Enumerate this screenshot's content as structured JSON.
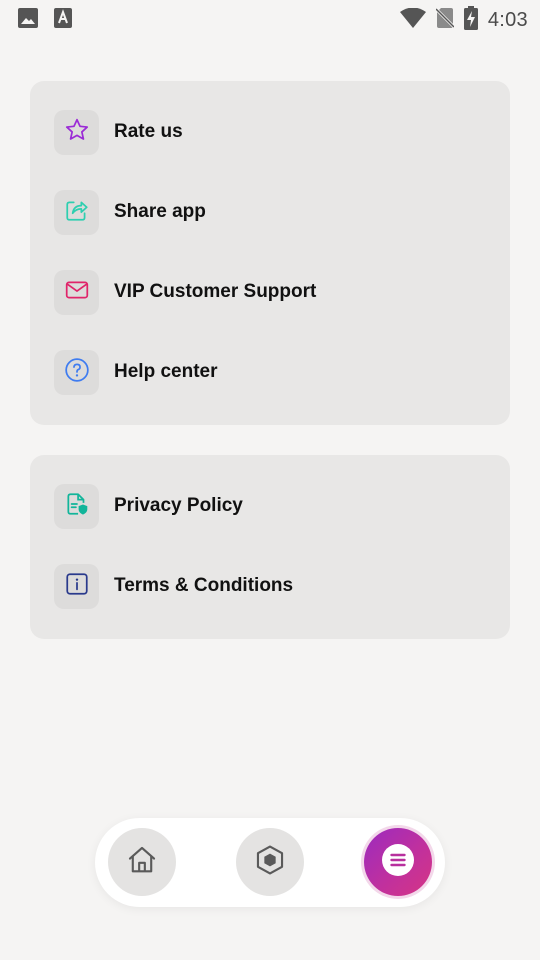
{
  "status_bar": {
    "time": "4:03",
    "left_icons": [
      "image-icon",
      "keyboard-a-icon"
    ],
    "right_icons": [
      "wifi-icon",
      "no-sim-icon",
      "battery-charging-icon"
    ]
  },
  "menu_group_1": {
    "items": [
      {
        "label": "Rate us",
        "icon": "star-icon",
        "color": "#9b2bd6"
      },
      {
        "label": "Share app",
        "icon": "share-icon",
        "color": "#2ecfb0"
      },
      {
        "label": "VIP Customer Support",
        "icon": "mail-icon",
        "color": "#e0246a"
      },
      {
        "label": "Help center",
        "icon": "help-circle-icon",
        "color": "#3f7cf0"
      }
    ]
  },
  "menu_group_2": {
    "items": [
      {
        "label": "Privacy Policy",
        "icon": "privacy-document-icon",
        "color": "#12b59a"
      },
      {
        "label": "Terms & Conditions",
        "icon": "info-square-icon",
        "color": "#2a3a8c"
      }
    ]
  },
  "bottom_nav": {
    "items": [
      {
        "name": "home",
        "icon": "home-icon",
        "active": false
      },
      {
        "name": "explore",
        "icon": "cube-icon",
        "active": false
      },
      {
        "name": "menu",
        "icon": "menu-icon",
        "active": true
      }
    ],
    "active_gradient": [
      "#9b2bbf",
      "#d63584"
    ]
  }
}
